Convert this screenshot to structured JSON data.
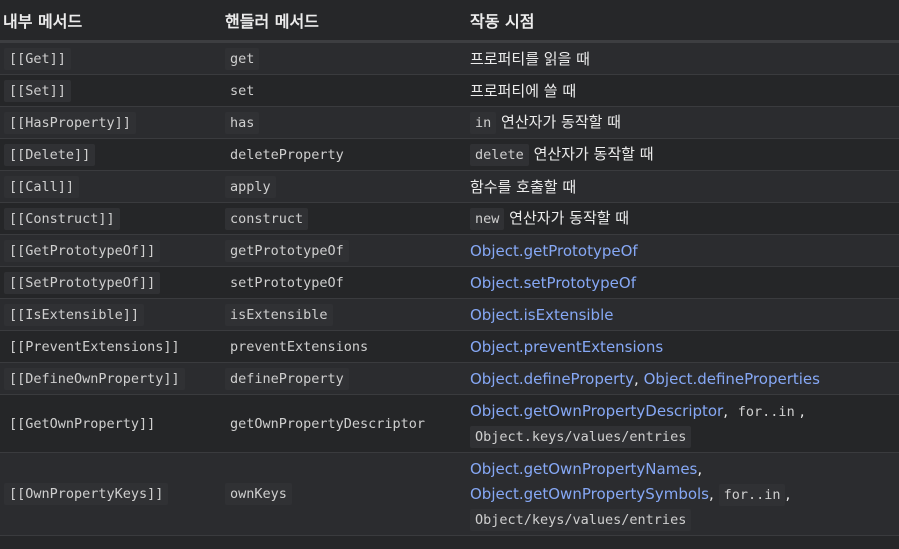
{
  "headers": [
    "내부 메서드",
    "핸들러 메서드",
    "작동 시점"
  ],
  "rows": [
    {
      "internal": "[[Get]]",
      "handler": "get",
      "when_text": "프로퍼티를 읽을 때"
    },
    {
      "internal": "[[Set]]",
      "handler": "set",
      "when_text": "프로퍼티에 쓸 때"
    },
    {
      "internal": "[[HasProperty]]",
      "handler": "has",
      "when_code": "in",
      "when_text": "연산자가 동작할 때"
    },
    {
      "internal": "[[Delete]]",
      "handler": "deleteProperty",
      "when_code": "delete",
      "when_text": "연산자가 동작할 때"
    },
    {
      "internal": "[[Call]]",
      "handler": "apply",
      "when_text": "함수를 호출할 때"
    },
    {
      "internal": "[[Construct]]",
      "handler": "construct",
      "when_code": "new",
      "when_text": "연산자가 동작할 때"
    },
    {
      "internal": "[[GetPrototypeOf]]",
      "handler": "getPrototypeOf",
      "when_link": "Object.getPrototypeOf"
    },
    {
      "internal": "[[SetPrototypeOf]]",
      "handler": "setPrototypeOf",
      "when_link": "Object.setPrototypeOf"
    },
    {
      "internal": "[[IsExtensible]]",
      "handler": "isExtensible",
      "when_link": "Object.isExtensible"
    },
    {
      "internal": "[[PreventExtensions]]",
      "handler": "preventExtensions",
      "when_link": "Object.preventExtensions"
    },
    {
      "internal": "[[DefineOwnProperty]]",
      "handler": "defineProperty",
      "when_link": "Object.defineProperty",
      "when_link2": "Object.defineProperties"
    },
    {
      "internal": "[[GetOwnProperty]]",
      "handler": "getOwnPropertyDescriptor",
      "when_link": "Object.getOwnPropertyDescriptor",
      "when_code": "for..in",
      "when_code2": "Object.keys/values/entries"
    },
    {
      "internal": "[[OwnPropertyKeys]]",
      "handler": "ownKeys",
      "when_link": "Object.getOwnPropertyNames",
      "when_link2": "Object.getOwnPropertySymbols",
      "when_code": "for..in",
      "when_code2": "Object/keys/values/entries"
    }
  ],
  "separator": ","
}
